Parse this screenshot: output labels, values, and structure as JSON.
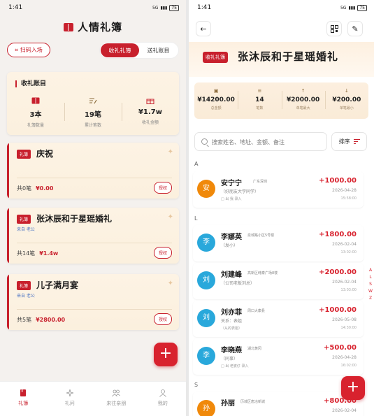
{
  "left": {
    "status": {
      "time": "1:41",
      "icons_text": "5G",
      "battery": "75"
    },
    "title": "人情礼簿",
    "scan_button": "扫码入场",
    "segments": [
      "收礼礼簿",
      "送礼账目"
    ],
    "summary": {
      "title": "收礼账目",
      "stats": [
        {
          "value": "3本",
          "label": "礼簿数量",
          "icon": "book-icon"
        },
        {
          "value": "19笔",
          "label": "累计笔数",
          "icon": "pen-icon"
        },
        {
          "value": "¥1.7w",
          "label": "收礼金额",
          "icon": "gift-icon"
        }
      ]
    },
    "books": [
      {
        "badge": "礼簿",
        "name": "庆祝",
        "subtitle": "",
        "count": "共0笔",
        "amount": "¥0.00",
        "action": "授权"
      },
      {
        "badge": "礼簿",
        "name": "张沐辰和于星瑶婚礼",
        "subtitle": "来自 老公",
        "count": "共14笔",
        "amount": "¥1.4w",
        "action": "授权"
      },
      {
        "badge": "礼簿",
        "name": "儿子满月宴",
        "subtitle": "来自 老公",
        "count": "共5笔",
        "amount": "¥2800.00",
        "action": "授权"
      }
    ],
    "fab": "+",
    "tabs": [
      {
        "label": "礼簿",
        "active": true,
        "icon": "book-icon"
      },
      {
        "label": "礼问",
        "active": false,
        "icon": "sparkle-icon"
      },
      {
        "label": "来往亲朋",
        "active": false,
        "icon": "people-icon"
      },
      {
        "label": "我的",
        "active": false,
        "icon": "person-icon"
      }
    ]
  },
  "right": {
    "status": {
      "time": "1:41",
      "icons_text": "5G",
      "battery": "75"
    },
    "header": {
      "badge": "收礼礼簿",
      "title": "张沐辰和于星瑶婚礼"
    },
    "stats": [
      {
        "value": "¥14200.00",
        "label": "总金额",
        "icon": "book-icon"
      },
      {
        "value": "14",
        "label": "笔数",
        "icon": "pen-icon"
      },
      {
        "value": "¥2000.00",
        "label": "单笔最大",
        "icon": "arrow-up-icon"
      },
      {
        "value": "¥200.00",
        "label": "单笔最小",
        "icon": "arrow-down-icon"
      }
    ],
    "search_placeholder": "搜索姓名、地址、金额、备注",
    "sort_label": "排序",
    "sections": [
      {
        "letter": "A",
        "entries": [
          {
            "avatar": "安",
            "color": "#f0890a",
            "name": "安宁宁",
            "location": "广东深圳",
            "line2": "（好朋友大学同学）",
            "line3": "□ 出 我 录入",
            "amount": "+1000.00",
            "date": "2026-04-28",
            "time": "15:58:00"
          }
        ]
      },
      {
        "letter": "L",
        "entries": [
          {
            "avatar": "李",
            "color": "#29a8db",
            "name": "李娜英",
            "location": "泉城路小区5号楼",
            "line2": "（发小）",
            "line3": "",
            "amount": "+1800.00",
            "date": "2026-02-04",
            "time": "13:02:00"
          },
          {
            "avatar": "刘",
            "color": "#29a8db",
            "name": "刘建峰",
            "location": "高新区韩泰广场8楼",
            "line2": "（公司老板刘总）",
            "line3": "",
            "amount": "+2000.00",
            "date": "2026-02-04",
            "time": "13:03:00"
          },
          {
            "avatar": "刘",
            "color": "#29a8db",
            "name": "刘亦菲",
            "location": "周口大康县",
            "line2": "关系：表姐",
            "line3": "（从的表姐）",
            "amount": "+1000.00",
            "date": "2026-05-08",
            "time": "14:30:00"
          },
          {
            "avatar": "李",
            "color": "#29a8db",
            "name": "李晓燕",
            "location": "湖北黄冈",
            "line2": "（同事）",
            "line3": "□ 出 老婆仔 录入",
            "amount": "+500.00",
            "date": "2026-04-28",
            "time": "16:02:00"
          }
        ]
      },
      {
        "letter": "S",
        "entries": [
          {
            "avatar": "孙",
            "color": "#f0890a",
            "name": "孙丽",
            "location": "历城区唐冶新城",
            "line2": "",
            "line3": "",
            "amount": "+800.00",
            "date": "2026-02-04",
            "time": ""
          }
        ]
      }
    ],
    "alpha_index": [
      "A",
      "L",
      "S",
      "W",
      "Z"
    ],
    "fab": "+"
  }
}
